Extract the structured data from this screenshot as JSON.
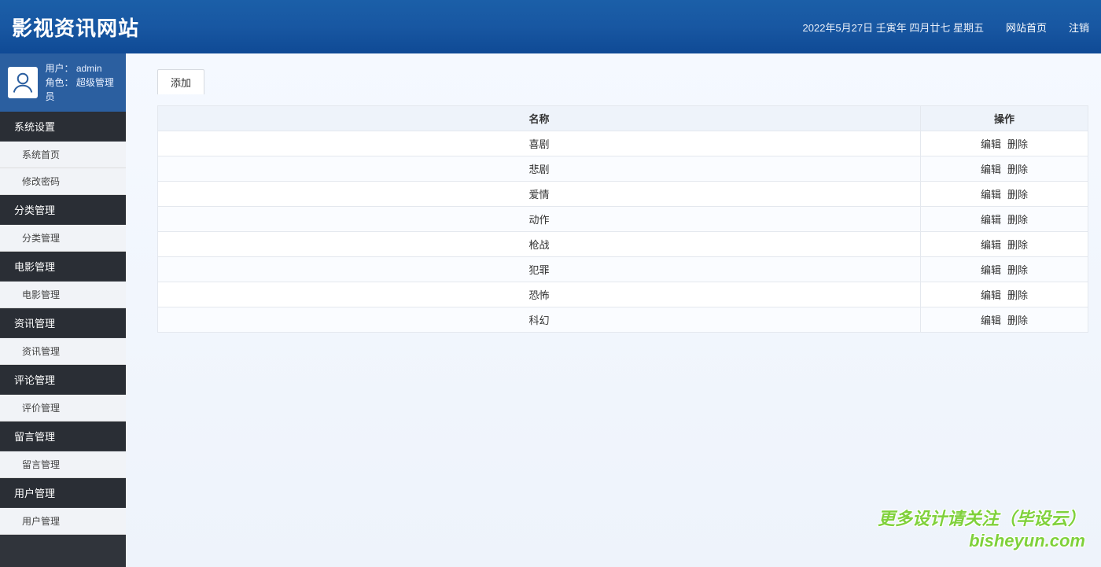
{
  "header": {
    "title": "影视资讯网站",
    "date_text": "2022年5月27日 壬寅年 四月廿七 星期五",
    "home_link": "网站首页",
    "logout_link": "注销"
  },
  "user": {
    "user_label": "用户：",
    "username": "admin",
    "role_label": "角色：",
    "role": "超级管理员"
  },
  "sidebar": {
    "sections": [
      {
        "header": "系统设置",
        "items": [
          "系统首页",
          "修改密码"
        ]
      },
      {
        "header": "分类管理",
        "items": [
          "分类管理"
        ]
      },
      {
        "header": "电影管理",
        "items": [
          "电影管理"
        ]
      },
      {
        "header": "资讯管理",
        "items": [
          "资讯管理"
        ]
      },
      {
        "header": "评论管理",
        "items": [
          "评价管理"
        ]
      },
      {
        "header": "留言管理",
        "items": [
          "留言管理"
        ]
      },
      {
        "header": "用户管理",
        "items": [
          "用户管理"
        ]
      }
    ]
  },
  "main": {
    "tab": "添加",
    "table": {
      "columns": [
        "名称",
        "操作"
      ],
      "op_edit": "编辑",
      "op_delete": "删除",
      "rows": [
        "喜剧",
        "悲剧",
        "爱情",
        "动作",
        "枪战",
        "犯罪",
        "恐怖",
        "科幻"
      ]
    }
  },
  "watermark": {
    "line1": "更多设计请关注（毕设云）",
    "line2": "bisheyun.com"
  }
}
